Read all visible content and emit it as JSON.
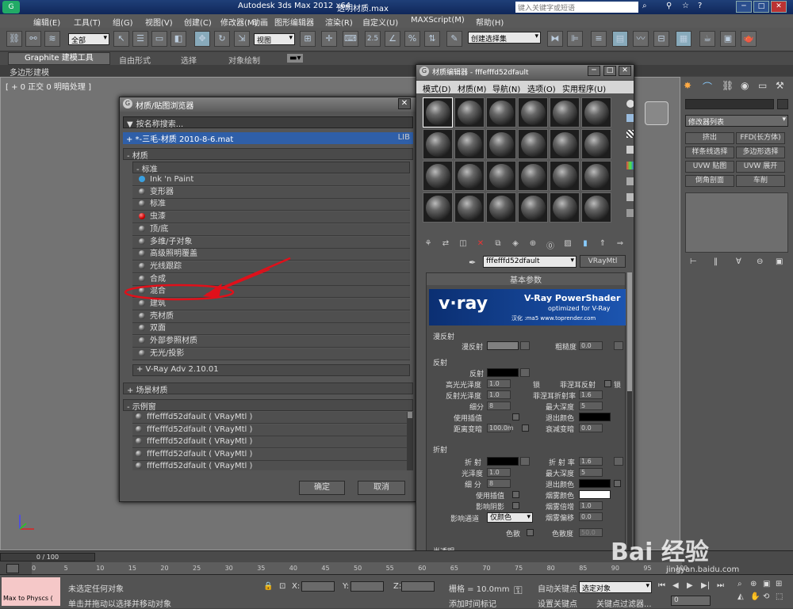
{
  "app": {
    "title": "Autodesk 3ds Max  2012 x64",
    "filename": "透明材质.max",
    "search_placeholder": "键入关键字或短语"
  },
  "menu": [
    "编辑(E)",
    "工具(T)",
    "组(G)",
    "视图(V)",
    "创建(C)",
    "修改器(M)",
    "动画",
    "图形编辑器",
    "渲染(R)",
    "自定义(U)",
    "MAXScript(M)",
    "帮助(H)"
  ],
  "toolbar": {
    "selection_filter": "全部",
    "reference_coord": "视图",
    "spinner_value": "2.5",
    "named_selection": "创建选择集"
  },
  "ribbon": {
    "tabs": [
      "Graphite 建模工具",
      "自由形式",
      "选择",
      "对象绘制"
    ],
    "sub": "多边形建模"
  },
  "viewport": {
    "label": "[ + 0 正交 0 明暗处理 ]"
  },
  "browser": {
    "title": "材质/贴图浏览器",
    "search": "按名称搜索...",
    "library": "+ *-三毛-材质 2010-8-6.mat",
    "lib_tag": "LIB",
    "group_materials": "- 材质",
    "group_standard": "- 标准",
    "materials": [
      "Ink 'n Paint",
      "变形器",
      "标准",
      "虫漆",
      "顶/底",
      "多维/子对象",
      "高级照明覆盖",
      "光线跟踪",
      "合成",
      "混合",
      "建筑",
      "壳材质",
      "双面",
      "外部参照材质",
      "无光/投影"
    ],
    "vray_group": "+ V-Ray Adv 2.10.01",
    "scene_group": "+ 场景材质",
    "samples_group": "- 示例窗",
    "samples": [
      "fffefffd52dfault  ( VRayMtl )",
      "fffefffd52dfault  ( VRayMtl )",
      "fffefffd52dfault  ( VRayMtl )",
      "fffefffd52dfault  ( VRayMtl )",
      "fffefffd52dfault  ( VRayMtl )"
    ],
    "ok": "确定",
    "cancel": "取消"
  },
  "editor": {
    "title": "材质编辑器 - fffefffd52dfault",
    "menu": [
      "模式(D)",
      "材质(M)",
      "导航(N)",
      "选项(O)",
      "实用程序(U)"
    ],
    "mat_name": "fffefffd52dfault",
    "mat_type": "VRayMtl",
    "rollout": "基本参数",
    "banner_logo": "v·ray",
    "banner_title": "V-Ray PowerShader",
    "banner_sub": "optimized for V-Ray",
    "banner_credit": "汉化 :ma5 www.toprender.com",
    "diffuse_section": "漫反射",
    "diffuse_label": "漫反射",
    "roughness_label": "粗糙度",
    "roughness": "0.0",
    "reflect_section": "反射",
    "reflect": {
      "reflect": "反射",
      "hilight_gloss": "高光光泽度",
      "hilight_value": "1.0",
      "lock": "锁",
      "fresnel": "菲涅耳反射",
      "refl_gloss": "反射光泽度",
      "refl_gloss_value": "1.0",
      "fresnel_ior": "菲涅耳折射率",
      "fresnel_ior_value": "1.6",
      "subdivs": "细分",
      "subdivs_value": "8",
      "max_depth": "最大深度",
      "max_depth_value": "5",
      "use_interp": "使用插值",
      "exit_color": "退出颜色",
      "dim_dist": "距离变暗",
      "dim_dist_value": "100.0m",
      "dim_falloff": "衰减变暗",
      "dim_falloff_value": "0.0"
    },
    "refract_section": "折射",
    "refract": {
      "refract": "折 射",
      "ior": "折 射 率",
      "ior_value": "1.6",
      "gloss": "光泽度",
      "gloss_value": "1.0",
      "max_depth": "最大深度",
      "max_depth_value": "5",
      "subdivs": "细 分",
      "subdivs_value": "8",
      "exit_color": "退出颜色",
      "use_interp": "使用插值",
      "fog_color": "烟雾颜色",
      "affect_shadows": "影响阴影",
      "fog_mult": "烟雾倍增",
      "fog_mult_value": "1.0",
      "affect_channels": "影响通道",
      "affect_channels_value": "仅颜色",
      "fog_bias": "烟雾偏移",
      "fog_bias_value": "0.0",
      "dispersion": "色散",
      "abbe": "色散度",
      "abbe_value": "50.0"
    },
    "translucency": "半透明"
  },
  "command_panel": {
    "field": "",
    "modifier_list": "修改器列表",
    "buttons": [
      "挤出",
      "FFD(长方体)",
      "样条线选择",
      "多边形选择",
      "UVW 贴图",
      "UVW 展开",
      "倒角剖面",
      "车削"
    ]
  },
  "timeline": {
    "frame": "0 / 100",
    "ticks": [
      "0",
      "5",
      "10",
      "15",
      "20",
      "25",
      "30",
      "35",
      "40",
      "45",
      "50",
      "55",
      "60",
      "65",
      "70",
      "75",
      "80",
      "85",
      "90",
      "95",
      "100"
    ]
  },
  "status": {
    "script": "Max to Physcs (",
    "none_selected": "未选定任何对象",
    "hint": "单击并拖动以选择并移动对象",
    "x": "X:",
    "y": "Y:",
    "z": "Z:",
    "grid": "栅格 = 10.0mm",
    "auto_key": "自动关键点",
    "selected": "选定对象",
    "set_key": "设置关键点",
    "key_filter": "关键点过滤器...",
    "add_tag": "添加时间标记",
    "frame": "0"
  },
  "watermark": {
    "logo": "Bai 经验",
    "url": "jingyan.baidu.com"
  },
  "colors": {
    "accent": "#2b5aa8",
    "annotation_red": "#e0101a",
    "diffuse_swatch": "#808080",
    "black_swatch": "#000000",
    "white_swatch": "#ffffff"
  }
}
